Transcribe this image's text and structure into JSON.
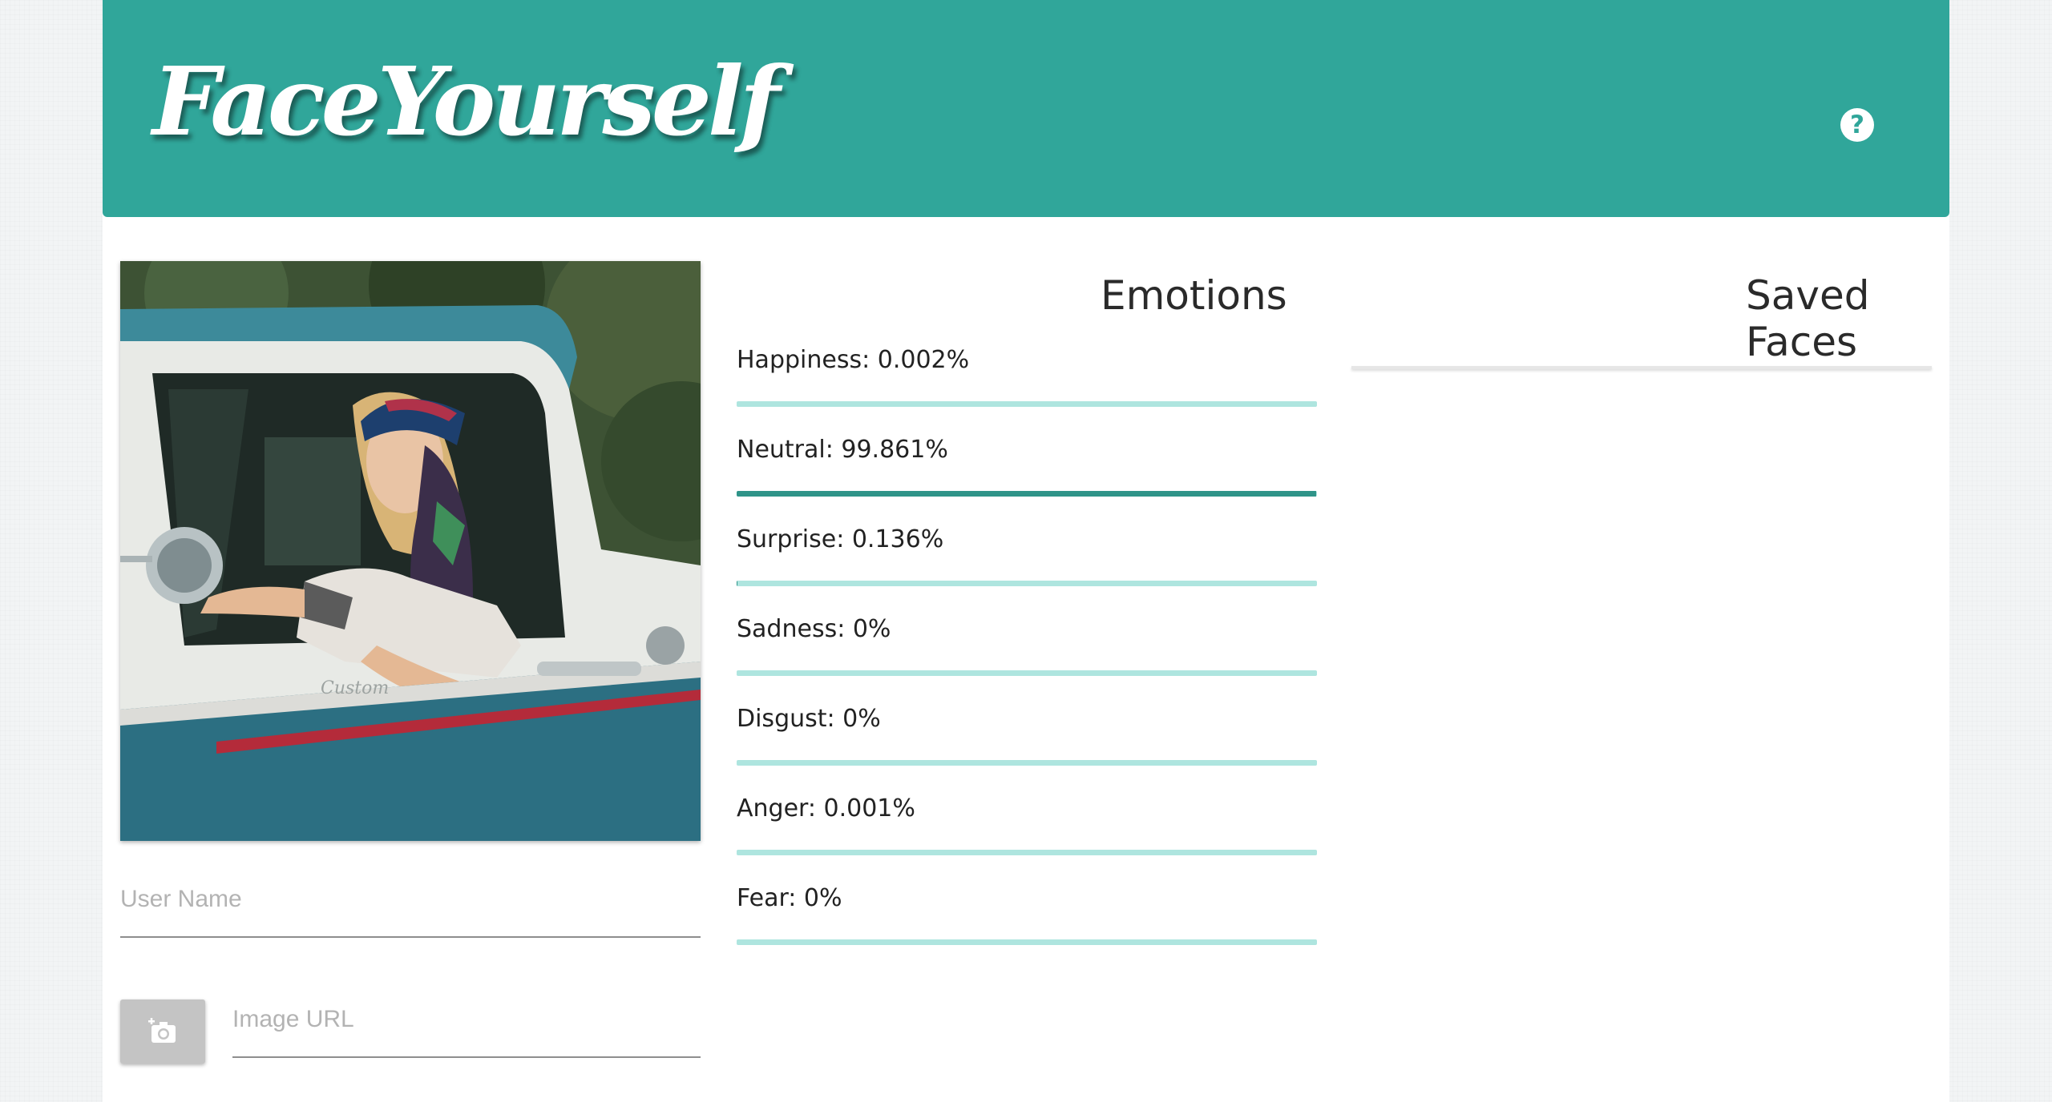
{
  "header": {
    "logo": "FaceYourself",
    "help_icon": "question-circle-icon"
  },
  "colors": {
    "header_bg": "#30a69a",
    "bar_track": "#aee5df",
    "bar_fill": "#2f9489"
  },
  "form": {
    "username_placeholder": "User Name",
    "image_url_placeholder": "Image URL",
    "camera_icon": "add-photo-camera-icon"
  },
  "emotions": {
    "title": "Emotions",
    "items": [
      {
        "label": "Happiness: 0.002%",
        "value": 0.002
      },
      {
        "label": "Neutral: 99.861%",
        "value": 99.861
      },
      {
        "label": "Surprise: 0.136%",
        "value": 0.136
      },
      {
        "label": "Sadness: 0%",
        "value": 0
      },
      {
        "label": "Disgust: 0%",
        "value": 0
      },
      {
        "label": "Anger: 0.001%",
        "value": 0.001
      },
      {
        "label": "Fear: 0%",
        "value": 0
      }
    ]
  },
  "saved": {
    "title": "Saved Faces"
  }
}
